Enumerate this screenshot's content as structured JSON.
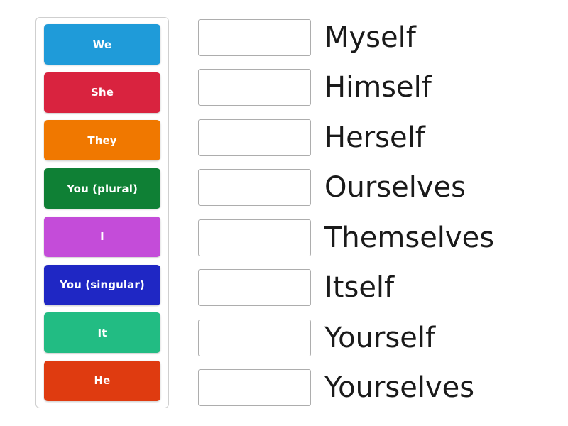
{
  "activity": {
    "type": "match-up-drag-and-drop",
    "tiles_panel": {
      "name": "pronoun-tiles",
      "tiles": [
        {
          "label": "We",
          "color": "#1f9bd9"
        },
        {
          "label": "She",
          "color": "#d9233f"
        },
        {
          "label": "They",
          "color": "#f07800"
        },
        {
          "label": "You (plural)",
          "color": "#0f8035"
        },
        {
          "label": "I",
          "color": "#c44cd9"
        },
        {
          "label": "You (singular)",
          "color": "#1f27c4"
        },
        {
          "label": "It",
          "color": "#22bc83"
        },
        {
          "label": "He",
          "color": "#df3b10"
        }
      ]
    },
    "answers_panel": {
      "name": "reflexive-pronoun-answers",
      "rows": [
        {
          "slot_value": "",
          "word": "Myself"
        },
        {
          "slot_value": "",
          "word": "Himself"
        },
        {
          "slot_value": "",
          "word": "Herself"
        },
        {
          "slot_value": "",
          "word": "Ourselves"
        },
        {
          "slot_value": "",
          "word": "Themselves"
        },
        {
          "slot_value": "",
          "word": "Itself"
        },
        {
          "slot_value": "",
          "word": "Yourself"
        },
        {
          "slot_value": "",
          "word": "Yourselves"
        }
      ]
    }
  }
}
